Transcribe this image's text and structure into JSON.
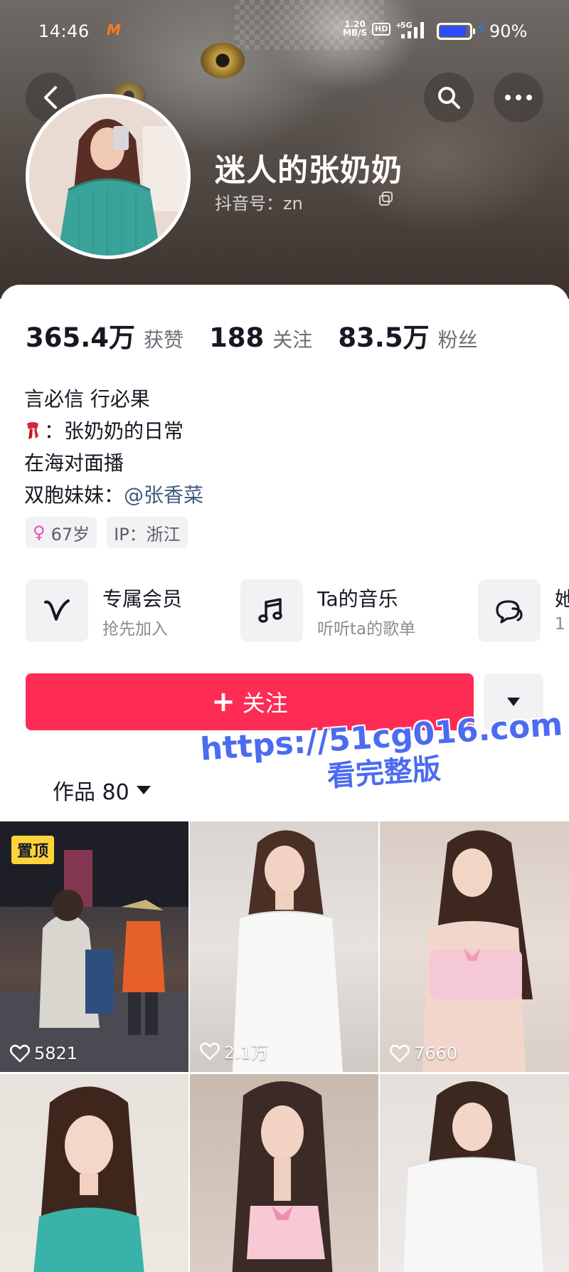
{
  "status_bar": {
    "time": "14:46",
    "carrier_mark": "M",
    "net_speed_value": "1.20",
    "net_speed_unit": "MB/S",
    "hd_badge": "HD",
    "network": "5G",
    "battery_percent": "90%",
    "battery_level": 0.9
  },
  "profile": {
    "username": "迷人的张奶奶",
    "douyin_id": "抖音号：zn",
    "stats": [
      {
        "value": "365.4万",
        "label": "获赞"
      },
      {
        "value": "188",
        "label": "关注"
      },
      {
        "value": "83.5万",
        "label": "粉丝"
      }
    ],
    "bio": {
      "line1": "言必信 行必果",
      "line2": "：张奶奶的日常",
      "line3": "在海对面播",
      "line4_prefix": "双胞妹妹：",
      "line4_mention": "@张香菜"
    },
    "tags": {
      "age": "67岁",
      "ip": "IP：浙江"
    }
  },
  "features": [
    {
      "title": "专属会员",
      "subtitle": "抢先加入",
      "icon": "vip-v-icon"
    },
    {
      "title": "Ta的音乐",
      "subtitle": "听听ta的歌单",
      "icon": "music-note-icon"
    },
    {
      "title": "她",
      "subtitle": "1",
      "icon": "chat-bubbles-icon"
    }
  ],
  "actions": {
    "follow_label": "关注",
    "more_icon": "caret-down-icon"
  },
  "works_tab": {
    "label": "作品 80"
  },
  "watermark": {
    "line1": "https://51cg016.com",
    "line2": "看完整版"
  },
  "videos": [
    {
      "likes": "5821",
      "pinned_label": "置顶"
    },
    {
      "likes": "2.1万"
    },
    {
      "likes": "7660"
    },
    {
      "likes": ""
    },
    {
      "likes": ""
    },
    {
      "likes": ""
    }
  ],
  "colors": {
    "follow_button": "#fe2c55",
    "mention": "#3d5a80",
    "pin_badge": "#ffd43a",
    "watermark": "#4b6cf0"
  }
}
